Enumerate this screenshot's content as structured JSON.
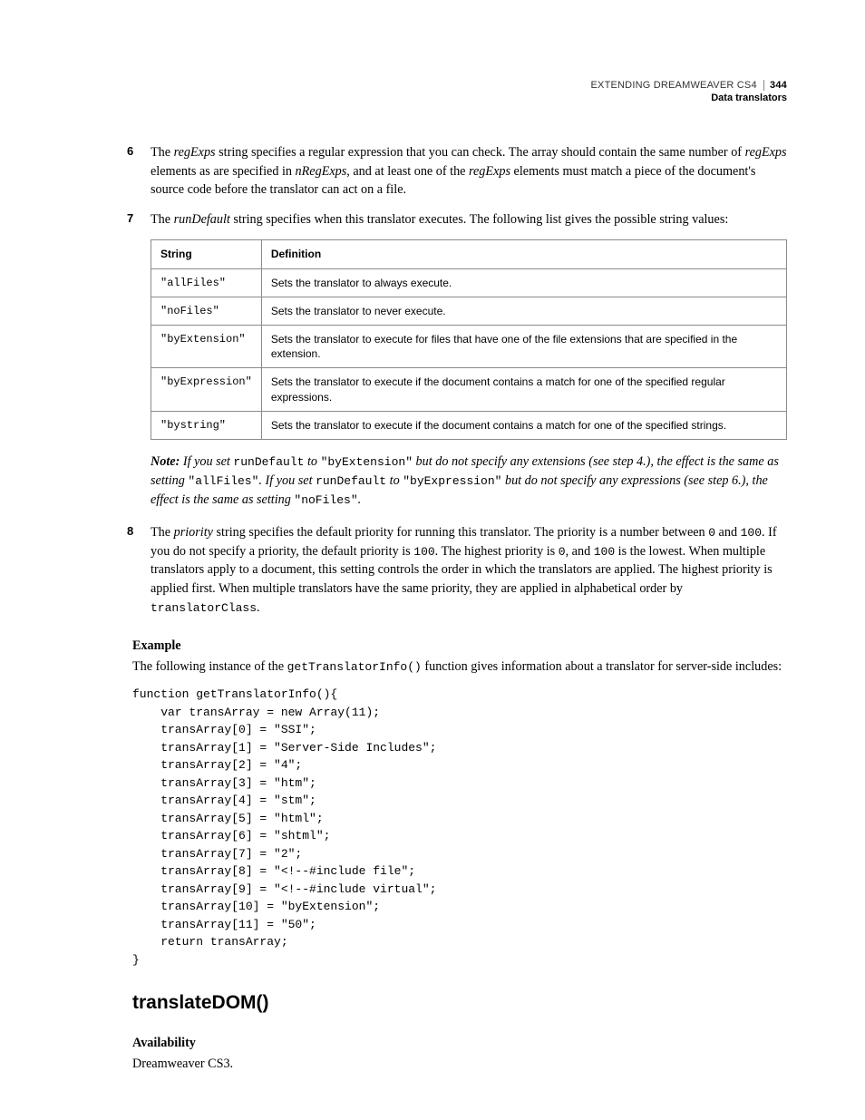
{
  "header": {
    "product": "EXTENDING DREAMWEAVER CS4",
    "section": "Data translators",
    "page_number": "344"
  },
  "list": {
    "item6": {
      "num": "6",
      "pre1": "The ",
      "regExps": "regExps",
      "mid1": " string specifies a regular expression that you can check. The array should contain the same number of ",
      "regExps2": "regExps",
      "mid2": " elements as are specified in ",
      "nRegExps": "nRegExps",
      "mid3": ", and at least one of the ",
      "regExps3": "regExps",
      "mid4": " elements must match a piece of the document's source code before the translator can act on a file."
    },
    "item7": {
      "num": "7",
      "pre1": "The ",
      "runDefault": "runDefault",
      "rest": " string specifies when this translator executes. The following list gives the possible string values:"
    },
    "item8": {
      "num": "8",
      "pre1": "The ",
      "priority": "priority",
      "seg1": " string specifies the default priority for running this translator. The priority is a number between ",
      "c0": "0",
      "seg2": " and ",
      "c100a": "100",
      "seg3": ". If you do not specify a priority, the default priority is ",
      "c100b": "100",
      "seg4": ". The highest priority is ",
      "c0b": "0",
      "seg5": ", and ",
      "c100c": "100",
      "seg6": " is the lowest. When multiple translators apply to a document, this setting controls the order in which the translators are applied. The highest priority is applied first. When multiple translators have the same priority, they are applied in alphabetical order by ",
      "translatorClass": "translatorClass",
      "period": "."
    }
  },
  "table": {
    "headers": {
      "c1": "String",
      "c2": "Definition"
    },
    "rows": [
      {
        "s": "\"allFiles\"",
        "d": "Sets the translator to always execute."
      },
      {
        "s": "\"noFiles\"",
        "d": "Sets the translator to never execute."
      },
      {
        "s": "\"byExtension\"",
        "d": "Sets the translator to execute for files that have one of the file extensions that are specified in the extension."
      },
      {
        "s": "\"byExpression\"",
        "d": "Sets the translator to execute if the document contains a match for one of the specified regular expressions."
      },
      {
        "s": "\"bystring\"",
        "d": "Sets the translator to execute if the document contains a match for one of the specified strings."
      }
    ]
  },
  "note": {
    "label": "Note:",
    "seg1": " If you set ",
    "runDefault1": "runDefault",
    "seg2": " to ",
    "byExt": "\"byExtension\"",
    "seg3": "  but do not specify any extensions (see step 4.), the effect is the same as setting ",
    "allFiles": "\"allFiles\"",
    "seg4": ". If you set ",
    "runDefault2": "runDefault",
    "seg5": " to ",
    "byExpr": "\"byExpression\"",
    "seg6": " but do not specify any expressions (see step 6.), the effect is the same as setting ",
    "noFiles": "\"noFiles\"",
    "period": "."
  },
  "example": {
    "heading": "Example",
    "intro_pre": "The following instance of the ",
    "fn": "getTranslatorInfo()",
    "intro_post": " function gives information about a translator for server-side includes:",
    "code": "function getTranslatorInfo(){\n    var transArray = new Array(11);\n    transArray[0] = \"SSI\";\n    transArray[1] = \"Server-Side Includes\";\n    transArray[2] = \"4\";\n    transArray[3] = \"htm\";\n    transArray[4] = \"stm\";\n    transArray[5] = \"html\";\n    transArray[6] = \"shtml\";\n    transArray[7] = \"2\";\n    transArray[8] = \"<!--#include file\";\n    transArray[9] = \"<!--#include virtual\";\n    transArray[10] = \"byExtension\";\n    transArray[11] = \"50\";\n    return transArray;\n}"
  },
  "api": {
    "name": "translateDOM()",
    "availability_label": "Availability",
    "availability_value": "Dreamweaver CS3."
  }
}
